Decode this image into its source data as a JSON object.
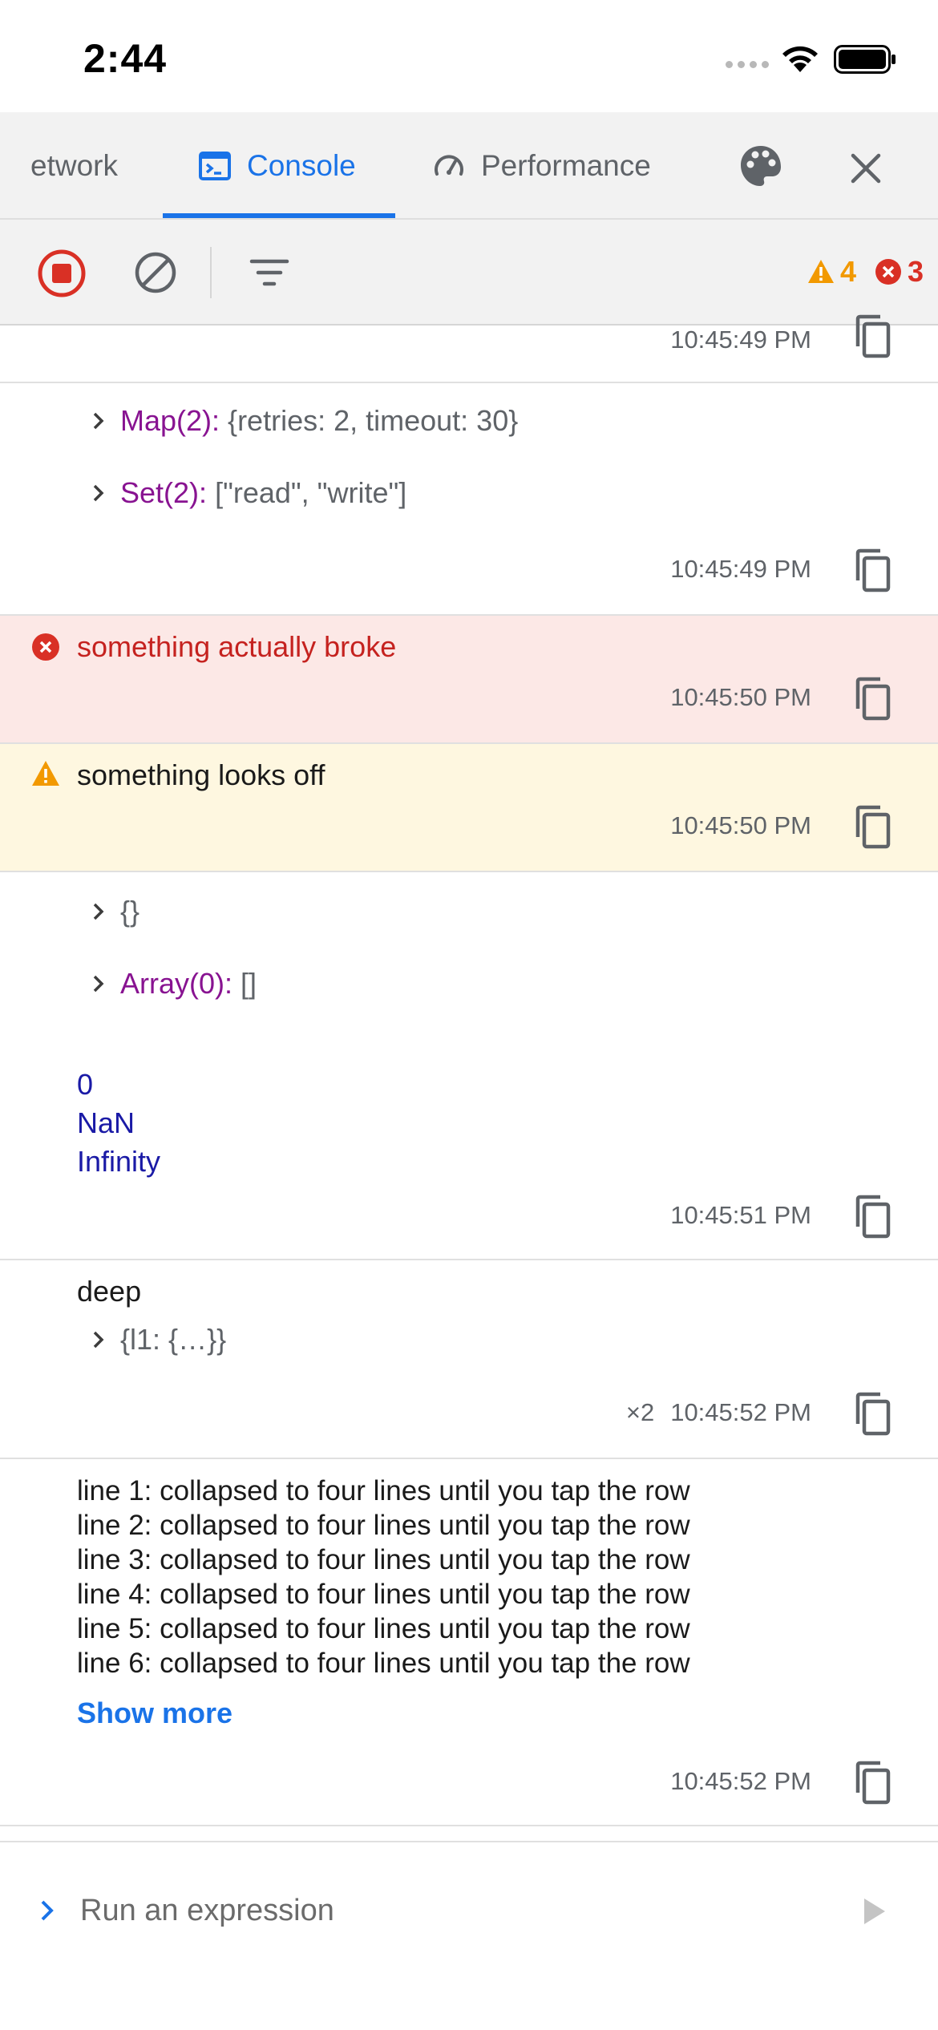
{
  "status_bar": {
    "time": "2:44"
  },
  "tabs": [
    {
      "label": "etwork",
      "icon": "network-icon"
    },
    {
      "label": "Console",
      "icon": "console-icon",
      "active": true
    },
    {
      "label": "Performance",
      "icon": "speedometer-icon"
    }
  ],
  "toolbar": {
    "warning_count": "4",
    "error_count": "3"
  },
  "logs": [
    {
      "timestamp": "10:45:49 PM"
    },
    {
      "items": [
        {
          "type": "Map(2):",
          "value": "{retries: 2, timeout: 30}"
        },
        {
          "type": "Set(2):",
          "value": "[\"read\", \"write\"]"
        }
      ],
      "timestamp": "10:45:49 PM"
    },
    {
      "level": "error",
      "message": "something actually broke",
      "timestamp": "10:45:50 PM"
    },
    {
      "level": "warn",
      "message": "something looks off",
      "timestamp": "10:45:50 PM"
    },
    {
      "items": [
        {
          "type": "",
          "value": "{}"
        },
        {
          "type": "Array(0):",
          "value": "[]"
        }
      ],
      "numbers": [
        "0",
        "NaN",
        "Infinity"
      ],
      "timestamp": "10:45:51 PM"
    },
    {
      "message": "deep",
      "items": [
        {
          "type": "",
          "value": "{l1: {…}}"
        }
      ],
      "repeat": "×2",
      "timestamp": "10:45:52 PM"
    },
    {
      "lines": [
        "line 1: collapsed to four lines until you tap the row",
        "line 2: collapsed to four lines until you tap the row",
        "line 3: collapsed to four lines until you tap the row",
        "line 4: collapsed to four lines until you tap the row",
        "line 5: collapsed to four lines until you tap the row",
        "line 6: collapsed to four lines until you tap the row"
      ],
      "show_more": "Show more",
      "timestamp": "10:45:52 PM"
    }
  ],
  "input": {
    "placeholder": "Run an expression"
  },
  "colors": {
    "accent": "#1a73e8",
    "error": "#d93025",
    "warning": "#f29900",
    "error_bg": "#fce8e6",
    "warning_bg": "#fef7e0",
    "type_purple": "#881391",
    "number_blue": "#1a1aa6"
  }
}
